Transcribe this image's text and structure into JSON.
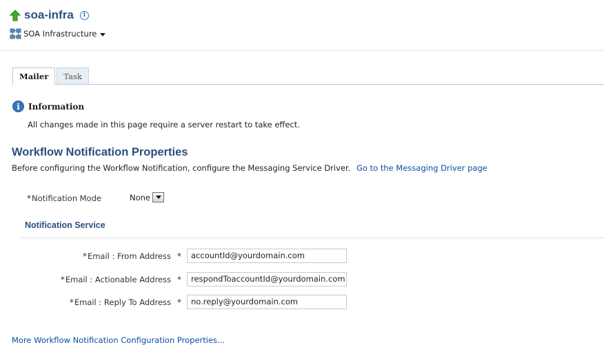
{
  "header": {
    "title": "soa-infra",
    "target_menu_label": "SOA Infrastructure",
    "icons": [
      "up-arrow-icon",
      "info-icon",
      "soa-infrastructure-icon",
      "chevron-down-icon"
    ]
  },
  "tabs": [
    {
      "label": "Mailer",
      "active": true
    },
    {
      "label": "Task",
      "active": false
    }
  ],
  "info": {
    "title": "Information",
    "message": "All changes made in this page require a server restart to take effect."
  },
  "section": {
    "title": "Workflow Notification Properties",
    "description": "Before configuring the Workflow Notification, configure the Messaging Service Driver.",
    "driver_link": "Go to the Messaging Driver page"
  },
  "notification_mode": {
    "required_mark": "*",
    "label": "Notification Mode",
    "value": "None"
  },
  "notification_service": {
    "title": "Notification Service",
    "fields": [
      {
        "label": "Email : From Address",
        "value": "accountId@yourdomain.com"
      },
      {
        "label": "Email : Actionable Address",
        "value": "respondToaccountId@yourdomain.com"
      },
      {
        "label": "Email : Reply To Address",
        "value": "no.reply@yourdomain.com"
      }
    ],
    "field_marker": "*"
  },
  "more_link": "More Workflow Notification Configuration Properties...",
  "colors": {
    "title_blue": "#2b4f7c",
    "link_blue": "#0b4fa2",
    "info_blue": "#3a74b8",
    "arrow_green": "#2e9a2e"
  }
}
